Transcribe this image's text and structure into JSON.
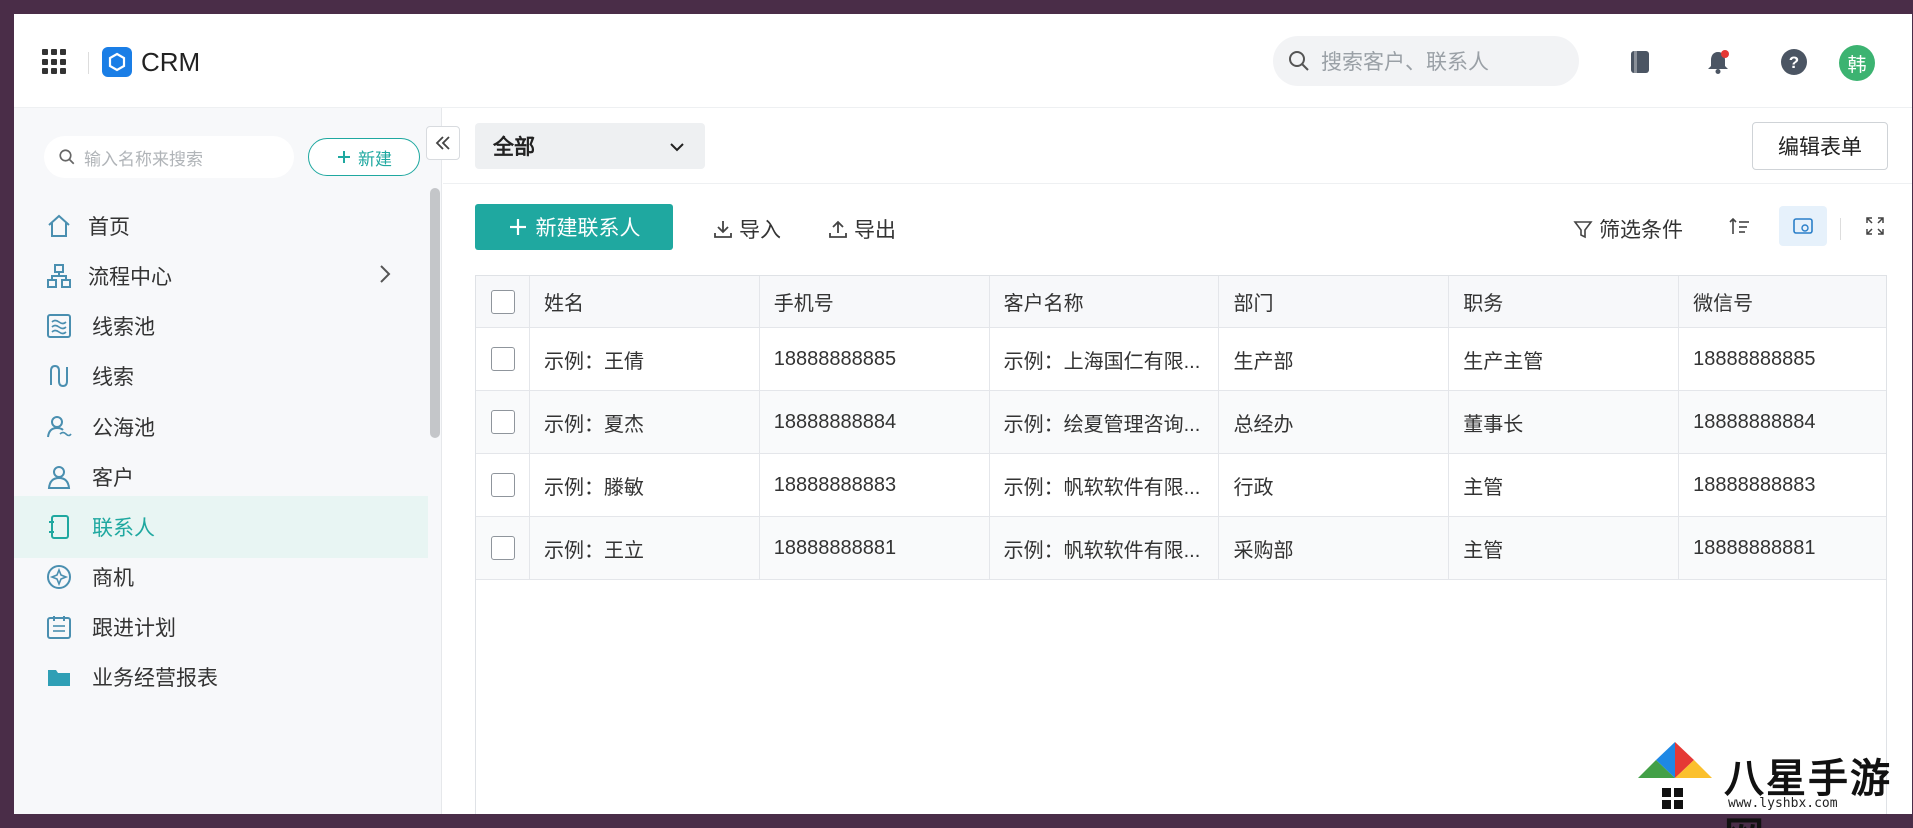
{
  "header": {
    "app_name": "CRM",
    "search_placeholder": "搜索客户、联系人",
    "avatar_text": "韩",
    "accent": "#1fa8a0",
    "logo_color": "#1a7ee6"
  },
  "sidebar": {
    "search_placeholder": "输入名称来搜索",
    "new_label": "新建",
    "items": [
      {
        "label": "首页",
        "icon": "home-icon"
      },
      {
        "label": "流程中心",
        "icon": "flow-icon",
        "has_chevron": true
      },
      {
        "label": "线索池",
        "icon": "lead-pool-icon"
      },
      {
        "label": "线索",
        "icon": "lead-icon"
      },
      {
        "label": "公海池",
        "icon": "public-pool-icon"
      },
      {
        "label": "客户",
        "icon": "customer-icon"
      },
      {
        "label": "联系人",
        "icon": "contact-icon",
        "active": true
      },
      {
        "label": "商机",
        "icon": "opportunity-icon"
      },
      {
        "label": "跟进计划",
        "icon": "plan-icon"
      },
      {
        "label": "业务经营报表",
        "icon": "folder-icon"
      }
    ]
  },
  "main": {
    "view_select": "全部",
    "edit_form_label": "编辑表单",
    "toolbar": {
      "new_contact": "新建联系人",
      "import": "导入",
      "export": "导出",
      "filter": "筛选条件"
    },
    "table": {
      "columns": [
        "姓名",
        "手机号",
        "客户名称",
        "部门",
        "职务",
        "微信号"
      ],
      "rows": [
        [
          "示例：王倩",
          "18888888885",
          "示例：上海国仁有限...",
          "生产部",
          "生产主管",
          "18888888885"
        ],
        [
          "示例：夏杰",
          "18888888884",
          "示例：绘夏管理咨询...",
          "总经办",
          "董事长",
          "18888888884"
        ],
        [
          "示例：滕敏",
          "18888888883",
          "示例：帆软软件有限...",
          "行政",
          "主管",
          "18888888883"
        ],
        [
          "示例：王立",
          "18888888881",
          "示例：帆软软件有限...",
          "采购部",
          "主管",
          "18888888881"
        ]
      ]
    }
  },
  "watermark": {
    "text": "八星手游网",
    "url": "www.lyshbx.com"
  }
}
